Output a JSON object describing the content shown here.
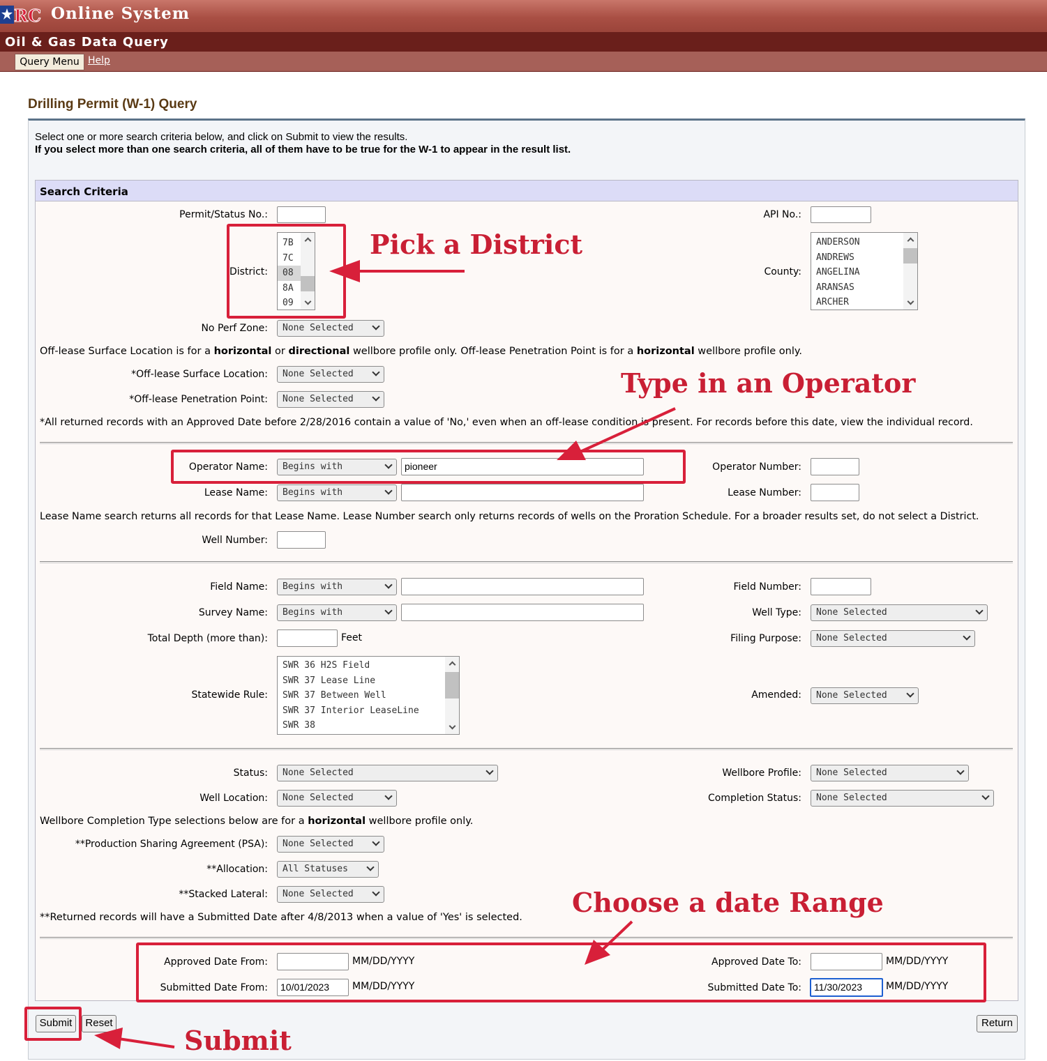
{
  "header": {
    "system_title": "Online System",
    "subtitle": "Oil & Gas Data Query",
    "menu_query": "Query Menu",
    "menu_help": "Help"
  },
  "page": {
    "title": "Drilling Permit (W-1) Query",
    "intro1": "Select one or more search criteria below, and click on Submit to view the results.",
    "intro2": "If you select more than one search criteria, all of them have to be true for the W-1 to appear in the result list.",
    "criteria_title": "Search Criteria"
  },
  "fields": {
    "permit_label": "Permit/Status No.:",
    "api_label": "API No.:",
    "district_label": "District:",
    "district_options": [
      "7B",
      "7C",
      "08",
      "8A",
      "09"
    ],
    "county_label": "County:",
    "county_options": [
      "ANDERSON",
      "ANDREWS",
      "ANGELINA",
      "ARANSAS",
      "ARCHER"
    ],
    "noperf_label": "No Perf Zone:",
    "none_selected": "None Selected",
    "offlease_note_a": "Off-lease Surface Location is for a ",
    "offlease_note_b": "horizontal",
    "offlease_note_c": " or ",
    "offlease_note_d": "directional",
    "offlease_note_e": " wellbore profile only. Off-lease Penetration Point is for a ",
    "offlease_note_f": "horizontal",
    "offlease_note_g": " wellbore profile only.",
    "offlease_surface_label": "*Off-lease Surface Location:",
    "offlease_penetration_label": "*Off-lease Penetration Point:",
    "approved_note": "*All returned records with an Approved Date before 2/28/2016 contain a value of 'No,' even when an off-lease condition is present. For records before this date, view the individual record.",
    "operator_name_label": "Operator Name:",
    "begins_with": "Begins with",
    "operator_name_value": "pioneer",
    "operator_number_label": "Operator Number:",
    "lease_name_label": "Lease Name:",
    "lease_number_label": "Lease Number:",
    "lease_note": "Lease Name search returns all records for that Lease Name. Lease Number search only returns records of wells on the Proration Schedule. For a broader results set, do not select a District.",
    "well_number_label": "Well Number:",
    "field_name_label": "Field Name:",
    "field_number_label": "Field Number:",
    "survey_name_label": "Survey Name:",
    "well_type_label": "Well Type:",
    "total_depth_label": "Total Depth (more than):",
    "feet": "Feet",
    "filing_purpose_label": "Filing Purpose:",
    "statewide_rule_label": "Statewide Rule:",
    "statewide_options": [
      "SWR 36 H2S Field",
      "SWR 37 Lease Line",
      "SWR 37 Between Well",
      "SWR 37 Interior LeaseLine",
      "SWR 38"
    ],
    "amended_label": "Amended:",
    "status_label": "Status:",
    "wellbore_profile_label": "Wellbore Profile:",
    "well_location_label": "Well Location:",
    "completion_status_label": "Completion Status:",
    "completion_note_a": "Wellbore Completion Type selections below are for a ",
    "completion_note_b": "horizontal",
    "completion_note_c": " wellbore profile only.",
    "psa_label": "**Production Sharing Agreement (PSA):",
    "allocation_label": "**Allocation:",
    "all_statuses": "All Statuses",
    "stacked_label": "**Stacked Lateral:",
    "returned_note": "**Returned records will have a Submitted Date after 4/8/2013 when a value of 'Yes' is selected.",
    "approved_from_label": "Approved Date From:",
    "approved_to_label": "Approved Date To:",
    "submitted_from_label": "Submitted Date From:",
    "submitted_to_label": "Submitted Date To:",
    "date_format": "MM/DD/YYYY",
    "submitted_from_value": "10/01/2023",
    "submitted_to_value": "11/30/2023"
  },
  "buttons": {
    "submit": "Submit",
    "reset": "Reset",
    "return": "Return"
  },
  "annotations": {
    "district": "Pick a District",
    "operator": "Type in an Operator",
    "date": "Choose a date Range",
    "submit": "Submit",
    "color": "#d8203a"
  }
}
